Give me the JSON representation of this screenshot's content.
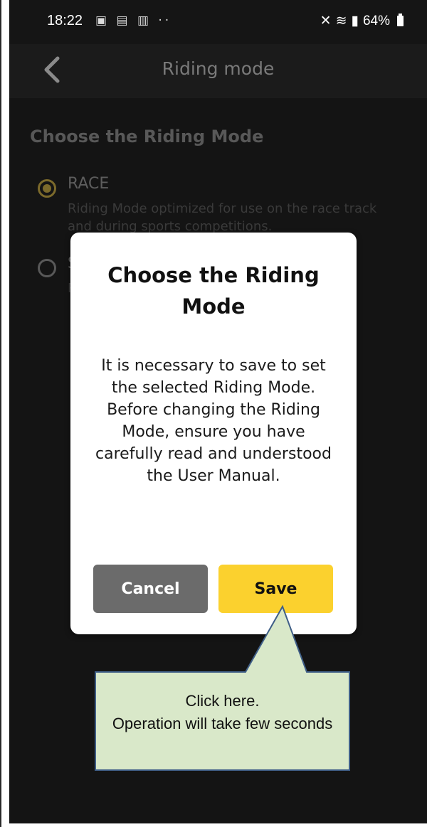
{
  "status_bar": {
    "time": "18:22",
    "left_icons": [
      "gallery-icon",
      "notification-icon",
      "tech-icon"
    ],
    "dots": "··",
    "battery_percent": "64%"
  },
  "app_bar": {
    "title": "Riding mode",
    "back_icon": "chevron-left-icon"
  },
  "content": {
    "section_title": "Choose the Riding Mode",
    "options": [
      {
        "label": "RACE",
        "description": "Riding Mode optimized for use on the race track and during sports competitions.",
        "selected": true
      },
      {
        "label": "S",
        "description": "R  d and in",
        "selected": false
      }
    ]
  },
  "dialog": {
    "title": "Choose the Riding Mode",
    "message": "It is necessary to save to set the selected Riding Mode. Before changing the Riding Mode, ensure you have carefully read and understood the User Manual.",
    "cancel_label": "Cancel",
    "save_label": "Save"
  },
  "callout": {
    "line1": "Click here.",
    "line2": "Operation will take few seconds"
  },
  "colors": {
    "background": "#141414",
    "accent": "#fbd12e",
    "cancel": "#6b6b6b",
    "callout_fill": "#d9e8c9",
    "callout_border": "#3f5e87"
  }
}
